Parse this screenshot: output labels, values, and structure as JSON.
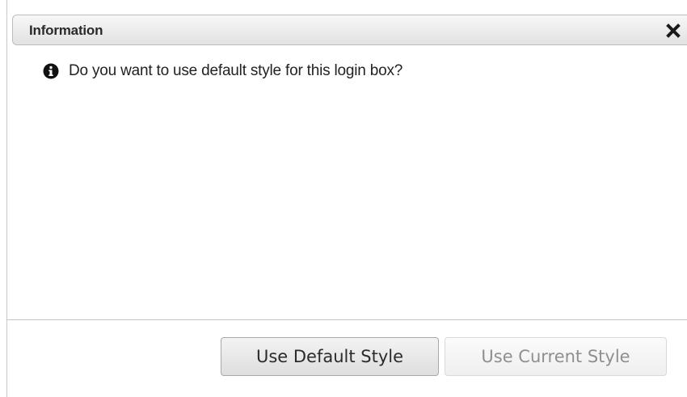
{
  "dialog": {
    "title": "Information",
    "close_icon": "close-icon",
    "message": "Do you want to use default style for this login box?",
    "message_icon": "info-icon",
    "buttons": {
      "default_label": "Use Default Style",
      "current_label": "Use Current Style",
      "current_disabled": true
    }
  },
  "colors": {
    "titlebar_top": "#f7f7f7",
    "titlebar_bottom": "#e2e2e2",
    "text": "#222222",
    "disabled_text": "#8f8f8f"
  }
}
